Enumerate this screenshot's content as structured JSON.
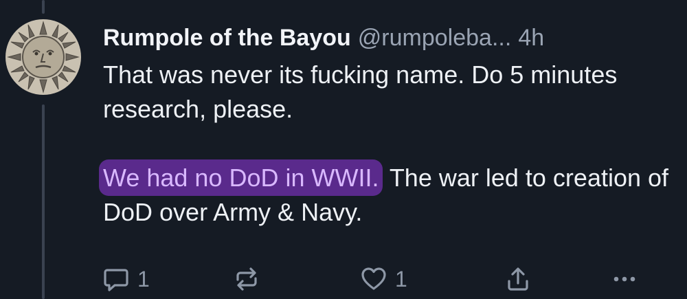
{
  "post": {
    "author_name": "Rumpole of the Bayou",
    "handle": "@rumpoleba...",
    "timestamp": "4h",
    "paragraph1": "That was never its fucking name. Do 5 minutes research, please.",
    "paragraph2_highlighted": "We had no DoD in WWII.",
    "paragraph2_rest": " The war led to creation of DoD over Army & Navy."
  },
  "actions": {
    "reply_count": "1",
    "like_count": "1"
  },
  "icons": {
    "avatar": "sun-face-avatar",
    "reply": "reply-icon",
    "repost": "repost-icon",
    "like": "heart-icon",
    "share": "share-icon",
    "more": "more-options-icon"
  },
  "colors": {
    "background": "#151b24",
    "text": "#eef1f5",
    "muted": "#9aa4b3",
    "highlight_bg": "#5a2a8c",
    "highlight_text": "#d9b8ff"
  }
}
